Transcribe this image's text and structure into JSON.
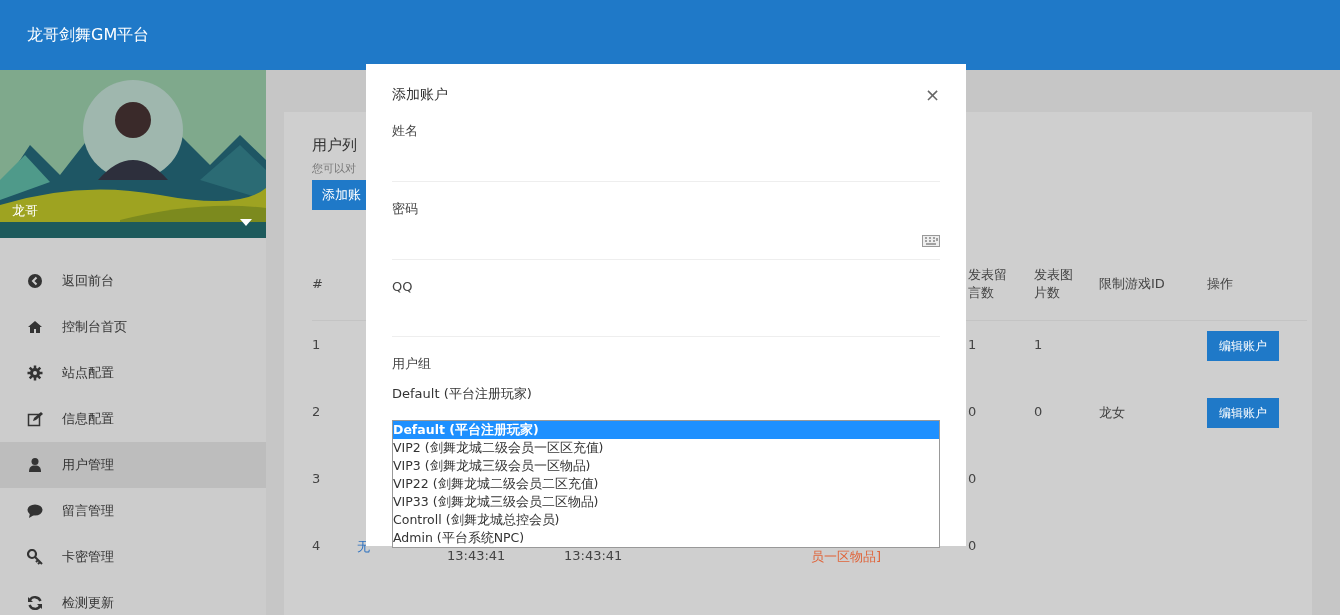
{
  "app": {
    "title": "龙哥剑舞GM平台"
  },
  "profile": {
    "name": "龙哥"
  },
  "sidebar": {
    "items": [
      {
        "label": "返回前台",
        "selected": false
      },
      {
        "label": "控制台首页",
        "selected": false
      },
      {
        "label": "站点配置",
        "selected": false
      },
      {
        "label": "信息配置",
        "selected": false
      },
      {
        "label": "用户管理",
        "selected": true
      },
      {
        "label": "留言管理",
        "selected": false
      },
      {
        "label": "卡密管理",
        "selected": false
      },
      {
        "label": "检测更新",
        "selected": false
      }
    ]
  },
  "panel": {
    "title": "用户列",
    "subtitle": "您可以对",
    "add_button": "添加账"
  },
  "table": {
    "columns": {
      "index": "#",
      "comments": "发表留言数",
      "images": "发表图片数",
      "game_id": "限制游戏ID",
      "actions": "操作"
    },
    "rows": [
      {
        "index": "1",
        "comments": "1",
        "images": "1",
        "button": "编辑账户"
      },
      {
        "index": "2",
        "comments": "0",
        "images": "0",
        "game_id": "龙女",
        "button": "编辑账户"
      },
      {
        "index": "3",
        "comments": "0"
      },
      {
        "index": "4",
        "name": "无",
        "created": "13:43:41",
        "login": "13:43:41",
        "group": "员一区物品]",
        "comments": "0"
      }
    ]
  },
  "modal": {
    "title": "添加账户",
    "close": "×",
    "fields": [
      {
        "label": "姓名",
        "kind": "text"
      },
      {
        "label": "密码",
        "kind": "password"
      },
      {
        "label": "QQ",
        "kind": "text"
      }
    ],
    "group": {
      "label": "用户组",
      "value": "Default (平台注册玩家)",
      "options": [
        {
          "label": "Default (平台注册玩家)",
          "selected": true
        },
        {
          "label": "VIP2 (剑舞龙城二级会员一区区充值)",
          "selected": false
        },
        {
          "label": "VIP3 (剑舞龙城三级会员一区物品)",
          "selected": false
        },
        {
          "label": "VIP22 (剑舞龙城二级会员二区充值)",
          "selected": false
        },
        {
          "label": "VIP33 (剑舞龙城三级会员二区物品)",
          "selected": false
        },
        {
          "label": "Controll (剑舞龙城总控会员)",
          "selected": false
        },
        {
          "label": "Admin (平台系统NPC)",
          "selected": false
        }
      ]
    }
  }
}
